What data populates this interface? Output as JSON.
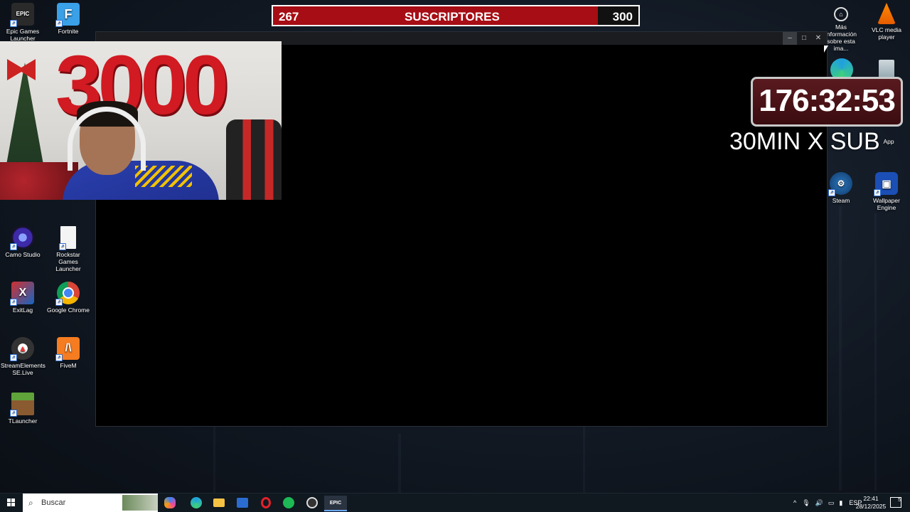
{
  "subscriber_goal": {
    "current": "267",
    "label": "SUSCRIPTORES",
    "goal": "300",
    "progress": 0.89,
    "fill_color": "#a70d14"
  },
  "timer": {
    "value": "176:32:53"
  },
  "promo_text": "30MIN X SUB",
  "webcam": {
    "balloon_text": "3000"
  },
  "desktop_icons": {
    "left": [
      {
        "label": "Epic Games Launcher",
        "icon": "epic-games-icon"
      },
      {
        "label": "Fortnite",
        "icon": "fortnite-icon"
      },
      {
        "label": "Camo Studio",
        "icon": "camo-studio-icon"
      },
      {
        "label": "Rockstar Games Launcher",
        "icon": "file-icon"
      },
      {
        "label": "ExitLag",
        "icon": "exitlag-icon"
      },
      {
        "label": "Google Chrome",
        "icon": "chrome-icon"
      },
      {
        "label": "StreamElements SE.Live",
        "icon": "streamelements-icon"
      },
      {
        "label": "FiveM",
        "icon": "fivem-icon"
      },
      {
        "label": "TLauncher",
        "icon": "minecraft-icon"
      }
    ],
    "right": [
      {
        "label": "Más información sobre esta imagen",
        "icon": "info-camera-icon"
      },
      {
        "label": "VLC media player",
        "icon": "vlc-icon"
      },
      {
        "label": "App",
        "icon": "app-icon"
      },
      {
        "label": "Steam",
        "icon": "steam-icon"
      },
      {
        "label": "Wallpaper Engine",
        "icon": "wallpaper-engine-icon"
      }
    ]
  },
  "right_icon_labels": {
    "info": "Más información sobre esta ima...",
    "vlc": "VLC media player",
    "app": "App",
    "steam": "Steam",
    "wallpaper": "Wallpaper Engine"
  },
  "taskbar": {
    "search_placeholder": "Buscar",
    "language": "ESP",
    "time": "22:41",
    "date": "28/12/2025",
    "notifications": "5"
  }
}
